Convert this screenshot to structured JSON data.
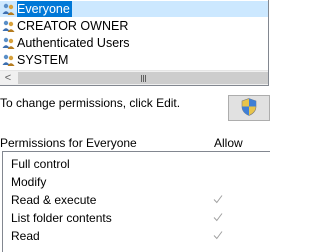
{
  "users": [
    {
      "name": "Everyone",
      "selected": true
    },
    {
      "name": "CREATOR OWNER",
      "selected": false
    },
    {
      "name": "Authenticated Users",
      "selected": false
    },
    {
      "name": "SYSTEM",
      "selected": false
    }
  ],
  "scrollbar": {
    "left_arrow": "<"
  },
  "change_text": "To change permissions, click Edit.",
  "edit_icon": "shield-icon",
  "permissions_header": "Permissions for Everyone",
  "allow_header": "Allow",
  "permissions": [
    {
      "name": "Full control",
      "allow": false
    },
    {
      "name": "Modify",
      "allow": false
    },
    {
      "name": "Read & execute",
      "allow": true
    },
    {
      "name": "List folder contents",
      "allow": true
    },
    {
      "name": "Read",
      "allow": true
    }
  ],
  "colors": {
    "selection": "#0078d7",
    "selection_row": "#cce8ff",
    "check": "#a0a0a0"
  }
}
